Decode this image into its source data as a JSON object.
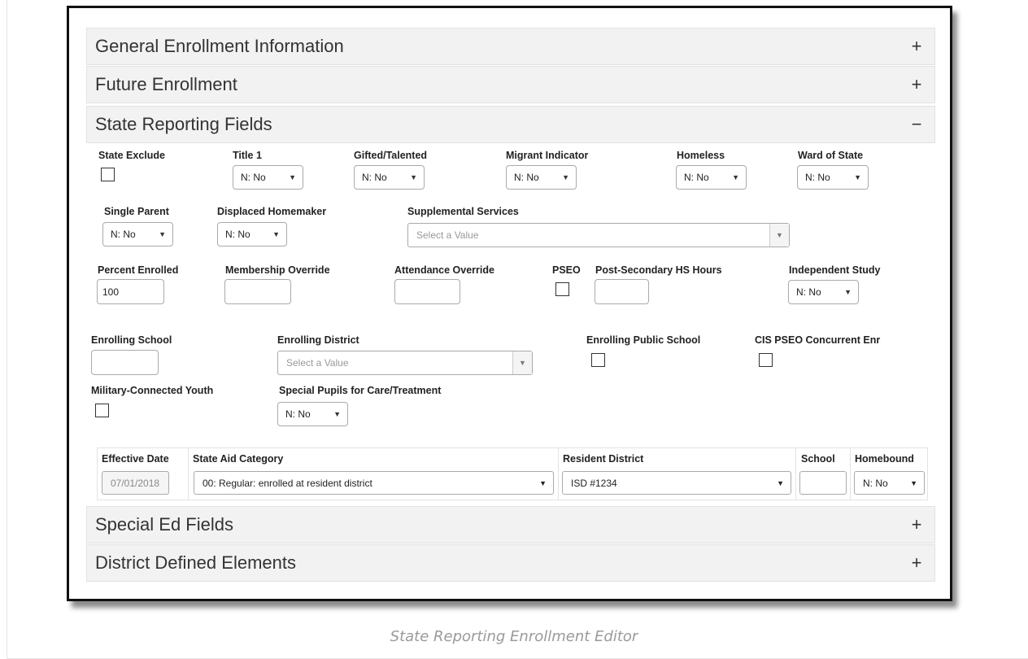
{
  "panels": {
    "general": {
      "title": "General Enrollment Information",
      "toggle": "+"
    },
    "future": {
      "title": "Future Enrollment",
      "toggle": "+"
    },
    "state": {
      "title": "State Reporting Fields",
      "toggle": "−"
    },
    "special_ed": {
      "title": "Special Ed Fields",
      "toggle": "+"
    },
    "district": {
      "title": "District Defined Elements",
      "toggle": "+"
    }
  },
  "fields": {
    "state_exclude": {
      "label": "State Exclude",
      "checked": false
    },
    "title1": {
      "label": "Title 1",
      "value": "N: No"
    },
    "gifted": {
      "label": "Gifted/Talented",
      "value": "N: No"
    },
    "migrant": {
      "label": "Migrant Indicator",
      "value": "N: No"
    },
    "homeless": {
      "label": "Homeless",
      "value": "N: No"
    },
    "ward": {
      "label": "Ward of State",
      "value": "N: No"
    },
    "single_parent": {
      "label": "Single Parent",
      "value": "N: No"
    },
    "displaced": {
      "label": "Displaced Homemaker",
      "value": "N: No"
    },
    "supplemental": {
      "label": "Supplemental Services",
      "placeholder": "Select a Value"
    },
    "percent_enrolled": {
      "label": "Percent Enrolled",
      "value": "100"
    },
    "membership_override": {
      "label": "Membership Override",
      "value": ""
    },
    "attendance_override": {
      "label": "Attendance Override",
      "value": ""
    },
    "pseo": {
      "label": "PSEO",
      "checked": false
    },
    "post_secondary": {
      "label": "Post-Secondary HS Hours",
      "value": ""
    },
    "independent_study": {
      "label": "Independent Study",
      "value": "N: No"
    },
    "enrolling_school": {
      "label": "Enrolling School",
      "value": ""
    },
    "enrolling_district": {
      "label": "Enrolling District",
      "placeholder": "Select a Value"
    },
    "enrolling_public": {
      "label": "Enrolling Public School",
      "checked": false
    },
    "cis_pseo": {
      "label": "CIS PSEO Concurrent Enr",
      "checked": false
    },
    "military": {
      "label": "Military-Connected Youth",
      "checked": false
    },
    "special_pupils": {
      "label": "Special Pupils for Care/Treatment",
      "value": "N: No"
    }
  },
  "grid": {
    "effective_date": {
      "header": "Effective Date",
      "value": "07/01/2018"
    },
    "state_aid": {
      "header": "State Aid Category",
      "value": "00: Regular: enrolled at resident district"
    },
    "resident_district": {
      "header": "Resident District",
      "value": "ISD #1234"
    },
    "school": {
      "header": "School",
      "value": ""
    },
    "homebound": {
      "header": "Homebound",
      "value": "N: No"
    }
  },
  "icons": {
    "dropdown_arrow": "▼"
  },
  "caption": "State Reporting Enrollment Editor"
}
